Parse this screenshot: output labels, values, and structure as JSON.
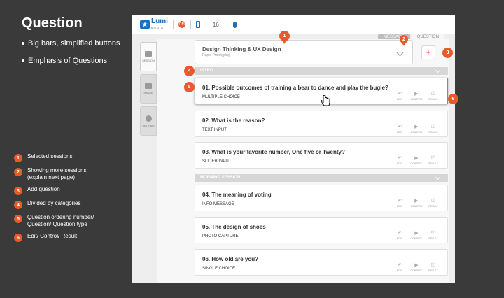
{
  "slide": {
    "title": "Question",
    "bullets": [
      "Big bars, simplified buttons",
      "Emphasis of Questions"
    ]
  },
  "legend": [
    {
      "num": "1",
      "text": "Selected sessions"
    },
    {
      "num": "2",
      "text": "Showing more sessions\n(explain next page)"
    },
    {
      "num": "3",
      "text": "Add question"
    },
    {
      "num": "4",
      "text": "Divided by categories"
    },
    {
      "num": "5",
      "text": "Question ordering number/\nQuestion/ Question type"
    },
    {
      "num": "6",
      "text": "Edit/ Control/ Result"
    }
  ],
  "app": {
    "logo_text": "Lumi",
    "logo_sub": "MEDIA",
    "badge_text": "RM",
    "count": "16",
    "mode_tabs": [
      "MESSAGE",
      "QUESTION"
    ],
    "sidetabs": [
      "SESSION",
      "IMAGE",
      "SETTING"
    ],
    "session": {
      "title": "Design Thinking & UX Design",
      "subtitle": "Rapid Prototyping"
    },
    "add_label": "+",
    "categories": [
      "INTRO",
      "MORNING SESSION"
    ],
    "actions": [
      "EDIT",
      "CONTROL",
      "RESULT"
    ],
    "questions": [
      {
        "title": "01. Possible outcomes of training a bear to dance and play the bugle?",
        "type": "MULTIPLE CHOICE"
      },
      {
        "title": "02. What is the reason?",
        "type": "TEXT INPUT"
      },
      {
        "title": "03. What is your favorite number, One five or Twenty?",
        "type": "SLIDER INPUT"
      },
      {
        "title": "04. The meaning of voting",
        "type": "INFO MESSAGE"
      },
      {
        "title": "05. The design of shoes",
        "type": "PHOTO CAPTURE"
      },
      {
        "title": "06. How old are you?",
        "type": "SINGLE CHOICE"
      }
    ]
  },
  "markers": [
    "1",
    "2",
    "3",
    "4",
    "5",
    "6"
  ],
  "colors": {
    "accent": "#e8592b",
    "brand": "#1d6fb8"
  }
}
